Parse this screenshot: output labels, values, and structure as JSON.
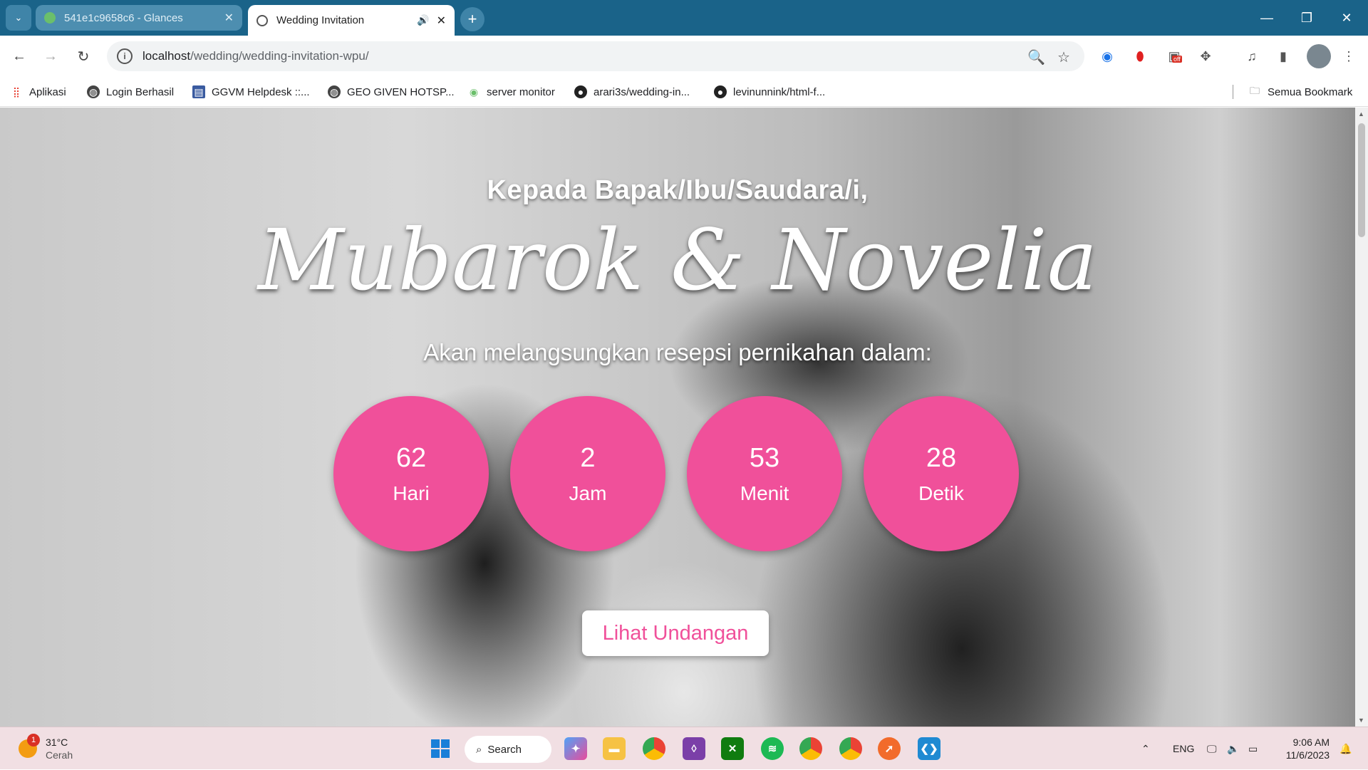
{
  "browser": {
    "tabs": [
      {
        "title": "541e1c9658c6 - Glances",
        "active": false
      },
      {
        "title": "Wedding Invitation",
        "active": true
      }
    ],
    "address": {
      "host": "localhost",
      "path": "/wedding/wedding-invitation-wpu/"
    },
    "bookmarks": [
      {
        "label": "Aplikasi"
      },
      {
        "label": "Login Berhasil"
      },
      {
        "label": "GGVM Helpdesk ::..."
      },
      {
        "label": "GEO GIVEN HOTSP..."
      },
      {
        "label": "server monitor"
      },
      {
        "label": "arari3s/wedding-in..."
      },
      {
        "label": "levinunnink/html-f..."
      }
    ],
    "all_bookmarks": "Semua Bookmark",
    "ext_badge": "off"
  },
  "hero": {
    "greeting": "Kepada Bapak/Ibu/Saudara/i,",
    "names": "Mubarok & Novelia",
    "subtitle": "Akan melangsungkan resepsi pernikahan dalam:",
    "countdown": [
      {
        "value": "62",
        "label": "Hari"
      },
      {
        "value": "2",
        "label": "Jam"
      },
      {
        "value": "53",
        "label": "Menit"
      },
      {
        "value": "28",
        "label": "Detik"
      }
    ],
    "cta": "Lihat Undangan",
    "accent_color": "#f0509a"
  },
  "taskbar": {
    "weather": {
      "temp": "31°C",
      "desc": "Cerah",
      "badge": "1"
    },
    "search": "Search",
    "language": "ENG",
    "time": "9:06 AM",
    "date": "11/6/2023"
  }
}
